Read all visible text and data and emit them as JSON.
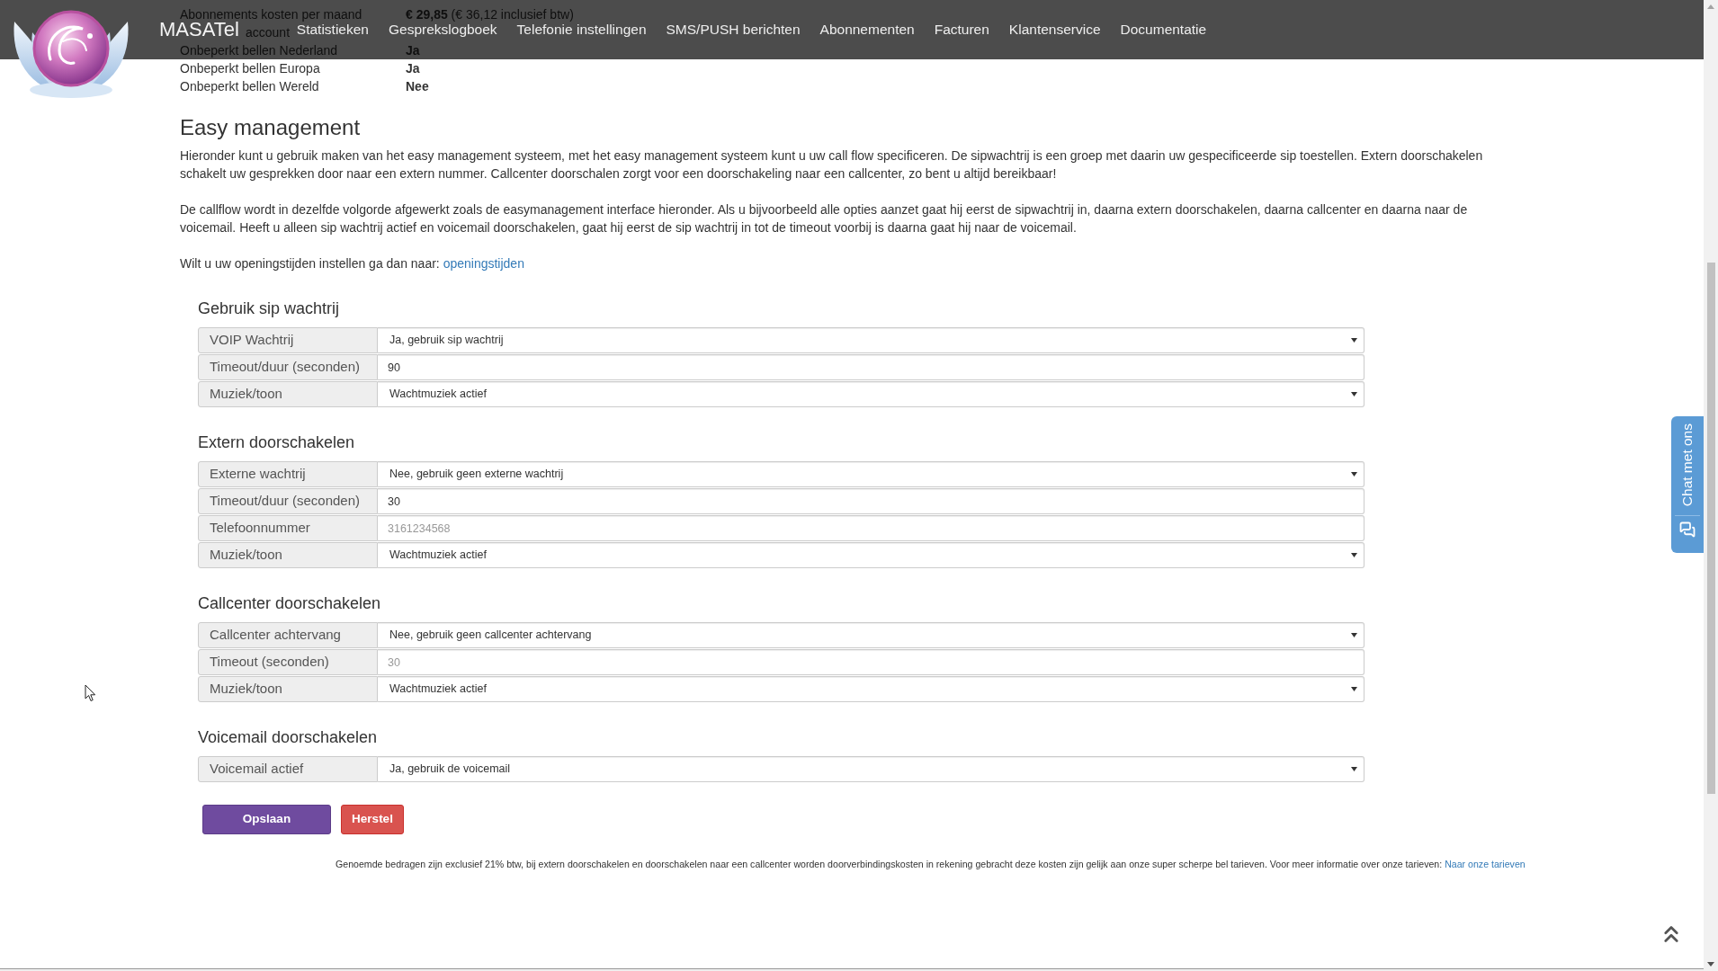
{
  "navbar": {
    "brand": "MASATel",
    "items": [
      "Statistieken",
      "Gesprekslogboek",
      "Telefonie instellingen",
      "SMS/PUSH berichten",
      "Abonnementen",
      "Facturen",
      "Klantenservice",
      "Documentatie"
    ]
  },
  "account_summary": [
    {
      "kind": "price",
      "label": "Abonnements kosten per maand",
      "value": "**€ 29,85** (€ 36,12 inclusief btw)"
    },
    {
      "kind": "covered",
      "label": "account"
    },
    {
      "kind": "plain",
      "label": "Onbeperkt bellen Nederland",
      "value": "Ja"
    },
    {
      "kind": "plain",
      "label": "Onbeperkt bellen Europa",
      "value": "Ja"
    },
    {
      "kind": "plain",
      "label": "Onbeperkt bellen Wereld",
      "value": "Nee"
    }
  ],
  "intro": {
    "title": "Easy management",
    "paragraphs": [
      "Hieronder kunt u gebruik maken van het easy management systeem, met het easy management systeem kunt u uw call flow specificeren. De sipwachtrij is een groep met daarin uw gespecificeerde sip toestellen. Extern doorschakelen schakelt uw gesprekken door naar een extern nummer. Callcenter doorschalen zorgt voor een doorschakeling naar een callcenter, zo bent u altijd bereikbaar!",
      "De callflow wordt in dezelfde volgorde afgewerkt zoals de easymanagement interface hieronder. Als u bijvoorbeeld alle opties aanzet gaat hij eerst de sipwachtrij in, daarna extern doorschakelen, daarna callcenter en daarna naar de voicemail. Heeft u alleen sip wachtrij actief en voicemail doorschakelen, gaat hij eerst de sip wachtrij in tot de timeout voorbij is daarna gaat hij naar de voicemail."
    ],
    "hours_text": "Wilt u uw openingstijden instellen ga dan naar:",
    "hours_link": "openingstijden"
  },
  "sections": [
    {
      "title": "Gebruik sip wachtrij",
      "fields": [
        {
          "kind": "select",
          "label": "VOIP Wachtrij",
          "value": "Ja, gebruik sip wachtrij"
        },
        {
          "kind": "input",
          "label": "Timeout/duur (seconden)",
          "value": "90"
        },
        {
          "kind": "select",
          "label": "Muziek/toon",
          "value": "Wachtmuziek actief"
        }
      ]
    },
    {
      "title": "Extern doorschakelen",
      "fields": [
        {
          "kind": "select",
          "label": "Externe wachtrij",
          "value": "Nee, gebruik geen externe wachtrij"
        },
        {
          "kind": "input",
          "label": "Timeout/duur (seconden)",
          "value": "30"
        },
        {
          "kind": "input",
          "label": "Telefoonnummer",
          "placeholder": "3161234568"
        },
        {
          "kind": "select",
          "label": "Muziek/toon",
          "value": "Wachtmuziek actief"
        }
      ]
    },
    {
      "title": "Callcenter doorschakelen",
      "fields": [
        {
          "kind": "select",
          "label": "Callcenter achtervang",
          "value": "Nee, gebruik geen callcenter achtervang"
        },
        {
          "kind": "input",
          "label": "Timeout (seconden)",
          "placeholder": "30"
        },
        {
          "kind": "select",
          "label": "Muziek/toon",
          "value": "Wachtmuziek actief"
        }
      ]
    },
    {
      "title": "Voicemail doorschakelen",
      "fields": [
        {
          "kind": "select",
          "label": "Voicemail actief",
          "value": "Ja, gebruik de voicemail"
        }
      ]
    }
  ],
  "buttons": [
    {
      "kind": "primary",
      "label": "Opslaan"
    },
    {
      "kind": "danger",
      "label": "Herstel"
    }
  ],
  "footer_note": {
    "text": "Genoemde bedragen zijn exclusief 21% btw, bij extern doorschakelen en doorschakelen naar een callcenter worden doorverbindingskosten in rekening gebracht deze kosten zijn gelijk aan onze super scherpe bel tarieven. Voor meer informatie over onze tarieven:",
    "link": "Naar onze tarieven"
  },
  "chat_tab": {
    "label": "Chat met ons"
  }
}
